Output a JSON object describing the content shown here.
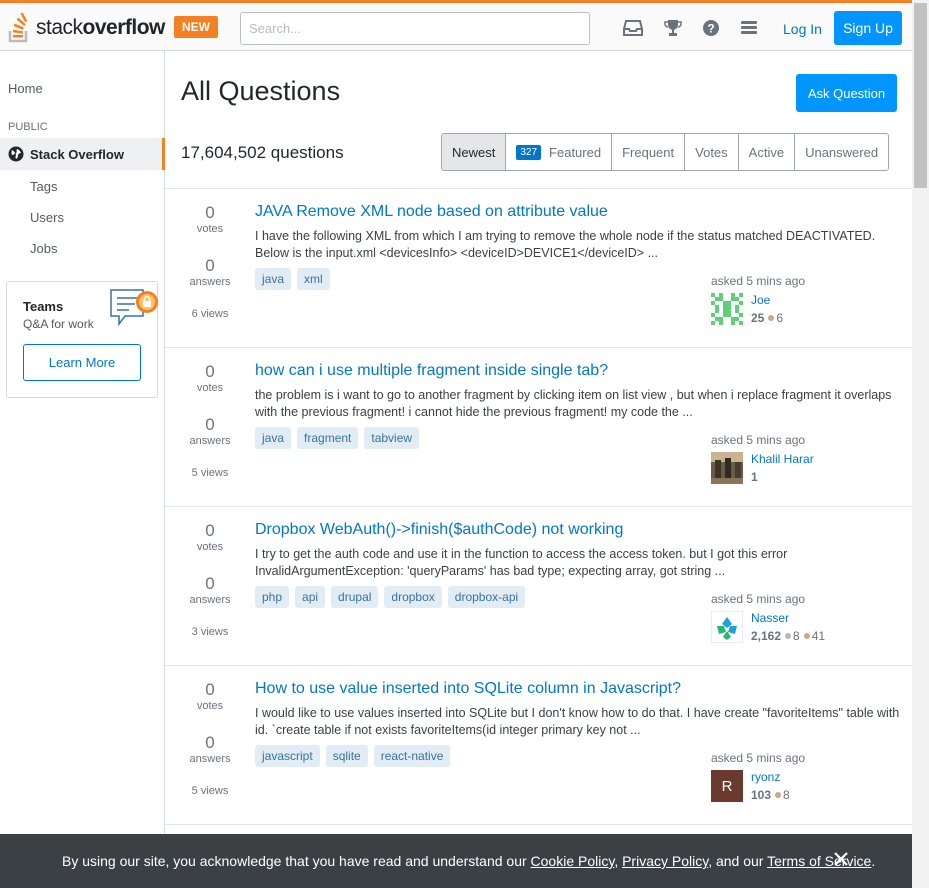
{
  "header": {
    "logo_text_light": "stack",
    "logo_text_bold": "overflow",
    "new_badge": "NEW",
    "search_placeholder": "Search...",
    "login_label": "Log In",
    "signup_label": "Sign Up",
    "accent_color": "#f48024",
    "primary_color": "#0095ff"
  },
  "sidebar": {
    "home": "Home",
    "public_heading": "PUBLIC",
    "active_item": "Stack Overflow",
    "items": [
      "Tags",
      "Users",
      "Jobs"
    ],
    "teams": {
      "title": "Teams",
      "subtitle": "Q&A for work",
      "button": "Learn More"
    }
  },
  "main": {
    "title": "All Questions",
    "ask_button": "Ask Question",
    "question_count": "17,604,502 questions",
    "filters": {
      "newest": "Newest",
      "featured_count": "327",
      "featured": "Featured",
      "frequent": "Frequent",
      "votes": "Votes",
      "active": "Active",
      "unanswered": "Unanswered"
    },
    "questions": [
      {
        "votes": "0",
        "votes_label": "votes",
        "answers": "0",
        "answers_label": "answers",
        "views": "6 views",
        "title": "JAVA Remove XML node based on attribute value",
        "excerpt": "I have the following XML from which I am trying to remove the whole node if the status matched DEACTIVATED. Below is the input.xml <devicesInfo> <deviceID>DEVICE1</deviceID> ...",
        "tags": [
          "java",
          "xml"
        ],
        "asked": "asked 5 mins ago",
        "user": "Joe",
        "rep": "25",
        "bronze": "6"
      },
      {
        "votes": "0",
        "votes_label": "votes",
        "answers": "0",
        "answers_label": "answers",
        "views": "5 views",
        "title": "how can i use multiple fragment inside single tab?",
        "excerpt": "the problem is i want to go to another fragment by clicking item on list view , but when i replace fragment it overlaps with the previous fragment! i cannot hide the previous fragment! my code the ...",
        "tags": [
          "java",
          "fragment",
          "tabview"
        ],
        "asked": "asked 5 mins ago",
        "user": "Khalil Harar",
        "rep": "1"
      },
      {
        "votes": "0",
        "votes_label": "votes",
        "answers": "0",
        "answers_label": "answers",
        "views": "3 views",
        "title": "Dropbox WebAuth()->finish($authCode) not working",
        "excerpt": "I try to get the auth code and use it in the function to access the access token. but I got this error InvalidArgumentException: 'queryParams' has bad type; expecting array, got string ...",
        "tags": [
          "php",
          "api",
          "drupal",
          "dropbox",
          "dropbox-api"
        ],
        "asked": "asked 5 mins ago",
        "user": "Nasser",
        "rep": "2,162",
        "silver": "8",
        "bronze": "41"
      },
      {
        "votes": "0",
        "votes_label": "votes",
        "answers": "0",
        "answers_label": "answers",
        "views": "5 views",
        "title": "How to use value inserted into SQLite column in Javascript?",
        "excerpt": "I would like to use values inserted into SQLite but I don't know how to do that. I have create \"favoriteItems\" table with id. `create table if not exists favoriteItems(id integer primary key not ...",
        "tags": [
          "javascript",
          "sqlite",
          "react-native"
        ],
        "asked": "asked 5 mins ago",
        "user": "ryonz",
        "avatar_letter": "R",
        "rep": "103",
        "bronze": "8"
      }
    ]
  },
  "cookie_banner": {
    "text_before": "By using our site, you acknowledge that you have read and understand our ",
    "cookie_policy": "Cookie Policy",
    "comma1": ", ",
    "privacy_policy": "Privacy Policy",
    "text_mid": ", and our ",
    "terms": "Terms of Service",
    "period": "."
  }
}
